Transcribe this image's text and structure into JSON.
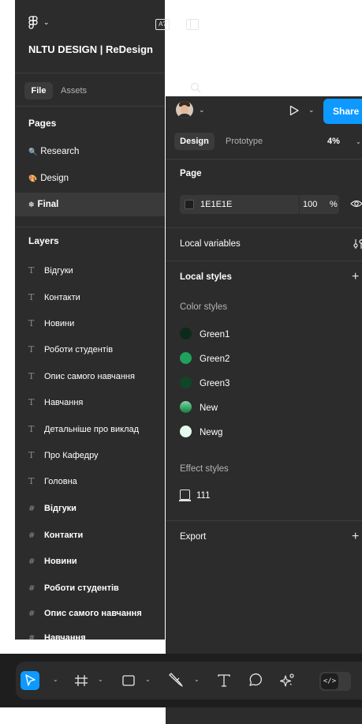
{
  "left_panel": {
    "project_title": "NLTU DESIGN | ReDesign",
    "ai_label": "A?",
    "tabs": {
      "file": "File",
      "assets": "Assets"
    },
    "pages_title": "Pages",
    "pages": [
      {
        "emoji": "🔍",
        "label": "Research"
      },
      {
        "emoji": "🎨",
        "label": "Design"
      },
      {
        "emoji": "❄",
        "label": "Final"
      }
    ],
    "layers_title": "Layers",
    "layers_text": [
      "Відгуки",
      "Контакти",
      "Новини",
      "Роботи студентів",
      "Опис самого навчання",
      "Навчання",
      "Детальніше про виклад",
      "Про Кафедру",
      "Головна"
    ],
    "layers_frames": [
      "Відгуки",
      "Контакти",
      "Новини",
      "Роботи студентів",
      "Опис самого навчання",
      "Навчання"
    ]
  },
  "right_panel": {
    "share_label": "Share",
    "tabs": {
      "design": "Design",
      "prototype": "Prototype"
    },
    "zoom": "4%",
    "page_title": "Page",
    "page_color": {
      "hex": "1E1E1E",
      "opacity": "100",
      "percent": "%"
    },
    "local_variables": "Local variables",
    "local_styles": "Local styles",
    "color_styles_title": "Color styles",
    "color_styles": [
      {
        "name": "Green1",
        "color": "#0c2a18"
      },
      {
        "name": "Green2",
        "color": "#1fa25c"
      },
      {
        "name": "Green3",
        "color": "#10452a"
      },
      {
        "name": "New",
        "color": "#3fae6e"
      },
      {
        "name": "Newg",
        "color": "#e4fbef"
      }
    ],
    "effect_styles_title": "Effect styles",
    "effect_styles": [
      {
        "name": "111"
      }
    ],
    "export_title": "Export"
  },
  "toolbar": {
    "code_label": "</>"
  },
  "colors": {
    "accent": "#0d99ff",
    "panel": "#2c2c2c",
    "divider": "#3d3d3d"
  }
}
